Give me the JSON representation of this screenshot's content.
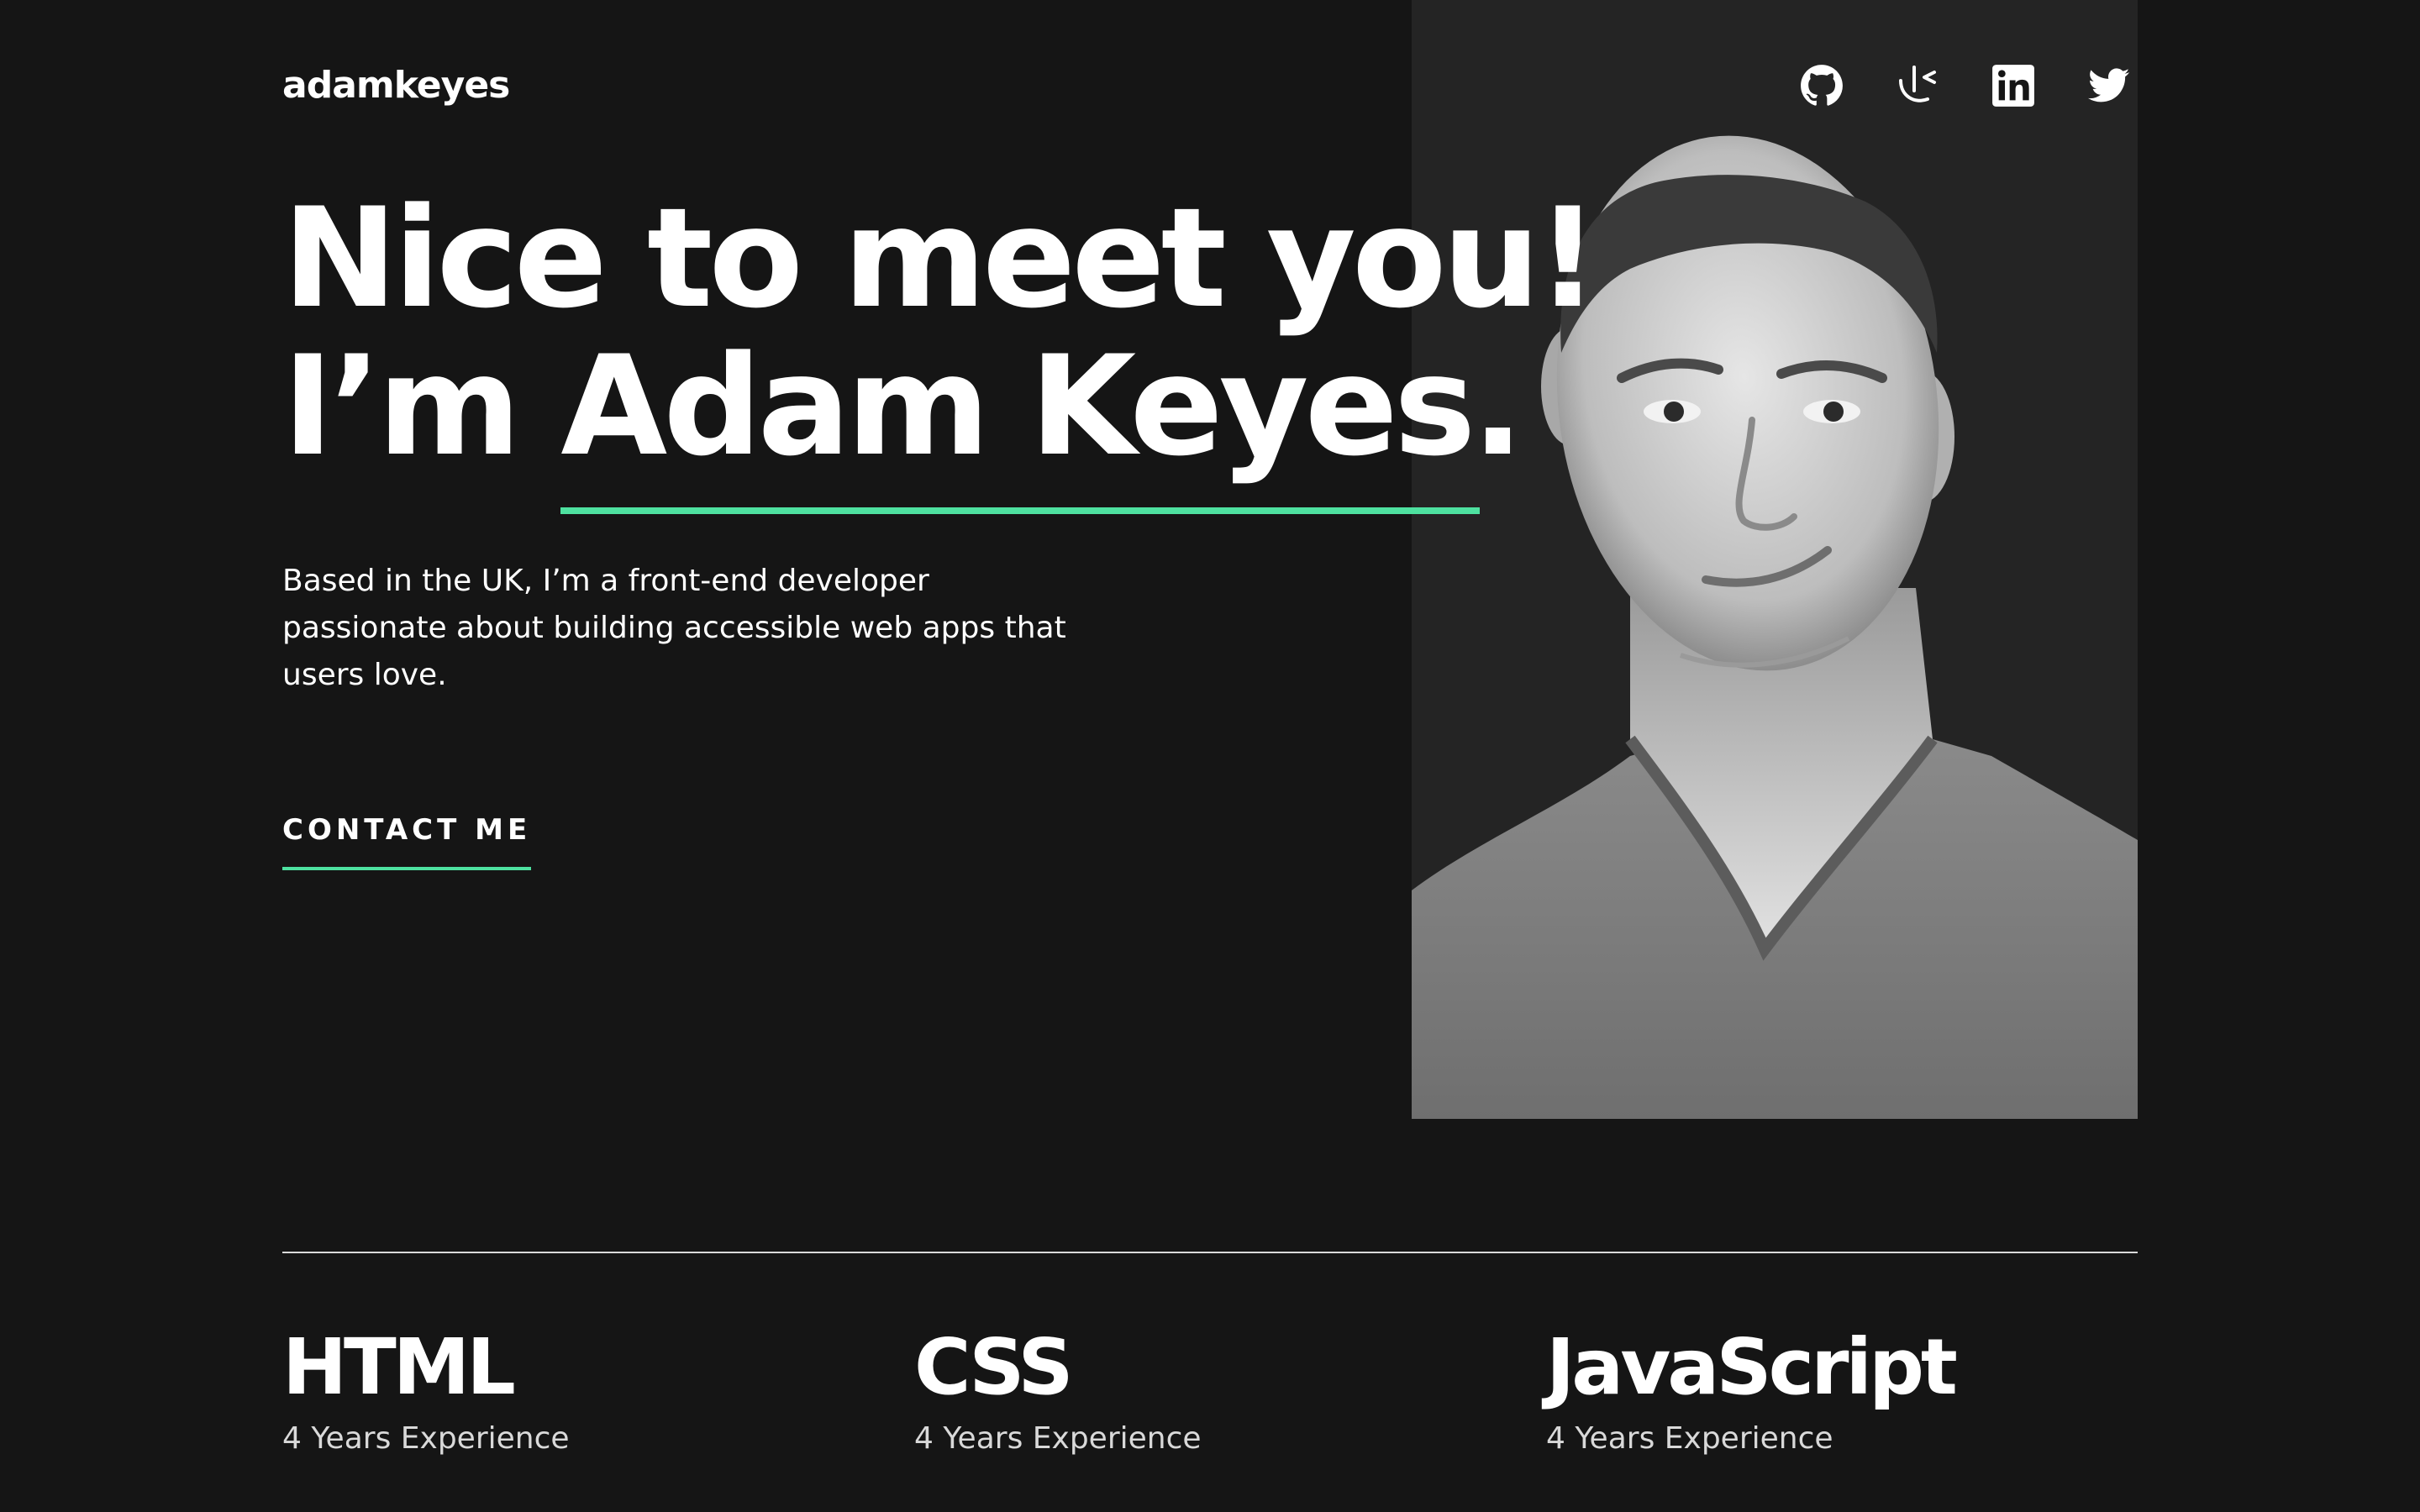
{
  "header": {
    "logo": "adamkeyes",
    "social": [
      {
        "name": "github",
        "icon": "github-icon"
      },
      {
        "name": "frontend-mentor",
        "icon": "frontend-mentor-icon"
      },
      {
        "name": "linkedin",
        "icon": "linkedin-icon"
      },
      {
        "name": "twitter",
        "icon": "twitter-icon"
      }
    ]
  },
  "hero": {
    "headline_line1": "Nice to meet you!",
    "headline_prefix": "I’m ",
    "headline_name": "Adam Keyes.",
    "intro": "Based in the UK, I’m a front-end developer passionate about building accessible web apps that users love.",
    "cta_label": "CONTACT ME"
  },
  "skills": [
    {
      "name": "HTML",
      "experience": "4 Years Experience"
    },
    {
      "name": "CSS",
      "experience": "4 Years Experience"
    },
    {
      "name": "JavaScript",
      "experience": "4 Years Experience"
    }
  ],
  "colors": {
    "background": "#151515",
    "panel": "#242424",
    "accent": "#4ee1a0",
    "text": "#ffffff",
    "muted": "#d9d9d9"
  }
}
